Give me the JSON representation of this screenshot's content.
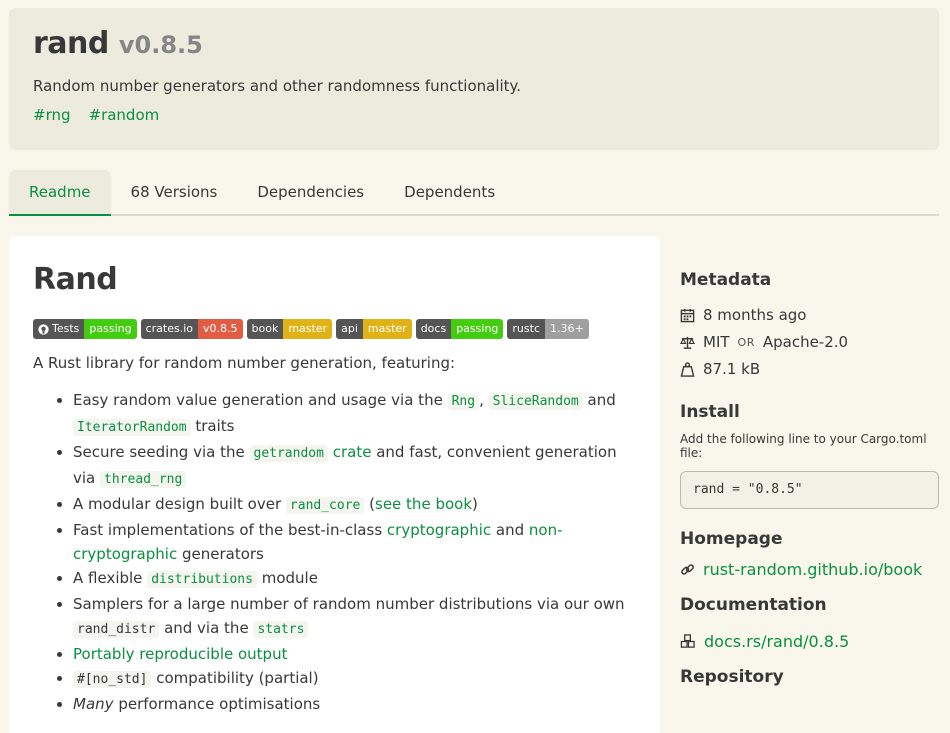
{
  "header": {
    "name": "rand",
    "version": "v0.8.5",
    "description": "Random number generators and other randomness functionality.",
    "keywords": [
      "#rng",
      "#random"
    ]
  },
  "tabs": [
    {
      "label": "Readme",
      "active": true
    },
    {
      "label": "68 Versions",
      "active": false
    },
    {
      "label": "Dependencies",
      "active": false
    },
    {
      "label": "Dependents",
      "active": false
    }
  ],
  "readme": {
    "title": "Rand",
    "badges": [
      {
        "left": "Tests",
        "right": "passing",
        "color": "#4c1",
        "github": true
      },
      {
        "left": "crates.io",
        "right": "v0.8.5",
        "color": "#e05d44"
      },
      {
        "left": "book",
        "right": "master",
        "color": "#dfb317"
      },
      {
        "left": "api",
        "right": "master",
        "color": "#dfb317"
      },
      {
        "left": "docs",
        "right": "passing",
        "color": "#4c1"
      },
      {
        "left": "rustc",
        "right": "1.36+",
        "color": "#9f9f9f"
      }
    ],
    "lead": "A Rust library for random number generation, featuring:",
    "items": {
      "i1_text": "Easy random value generation and usage via the",
      "i1_c1": "Rng",
      "i1_sep": ",",
      "i1_c2": "SliceRandom",
      "i1_and": "and",
      "i1_c3": "IteratorRandom",
      "i1_end": "traits",
      "i2_text": "Secure seeding via the",
      "i2_c1": "getrandom",
      "i2_link": "crate",
      "i2_mid": "and fast, convenient generation via",
      "i2_c2": "thread_rng",
      "i3_text": "A modular design built over",
      "i3_c1": "rand_core",
      "i3_open": "(",
      "i3_link": "see the book",
      "i3_close": ")",
      "i4_text": "Fast implementations of the best-in-class",
      "i4_link1": "cryptographic",
      "i4_and": "and",
      "i4_link2": "non-cryptographic",
      "i4_end": "generators",
      "i5_text": "A flexible",
      "i5_c1": "distributions",
      "i5_end": "module",
      "i6_text": "Samplers for a large number of random number distributions via our own",
      "i6_c1": "rand_distr",
      "i6_mid": "and via the",
      "i6_c2": "statrs",
      "i7_link": "Portably reproducible output",
      "i8_c1": "#[no_std]",
      "i8_end": "compatibility (partial)",
      "i9_em": "Many",
      "i9_end": "performance optimisations"
    }
  },
  "sidebar": {
    "metadata_heading": "Metadata",
    "published": "8 months ago",
    "license_a": "MIT",
    "license_or": "OR",
    "license_b": "Apache-2.0",
    "size": "87.1 kB",
    "install_heading": "Install",
    "install_hint": "Add the following line to your Cargo.toml file:",
    "install_line": "rand = \"0.8.5\"",
    "homepage_heading": "Homepage",
    "homepage_link": "rust-random.github.io/book",
    "documentation_heading": "Documentation",
    "documentation_link": "docs.rs/rand/0.8.5",
    "repository_heading": "Repository"
  },
  "colors": {
    "accent": "#0a8f40",
    "background": "#f9f7ec",
    "header_bg": "#edebdd"
  },
  "icons": [
    "github-icon",
    "calendar-icon",
    "scale-icon",
    "weight-icon",
    "link-icon",
    "cubes-icon"
  ]
}
